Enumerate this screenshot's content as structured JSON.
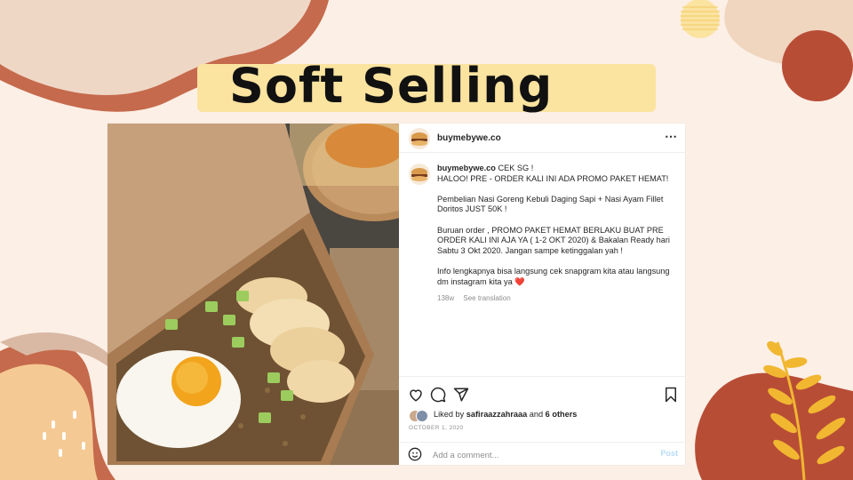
{
  "slide": {
    "title": "Soft Selling",
    "colors": {
      "background": "#fcefe6",
      "title_highlight": "#fbe3a0",
      "terracotta": "#c56a4c",
      "maroon": "#9a3b2c",
      "mustard": "#f1b731"
    }
  },
  "post": {
    "username": "buymebywe.co",
    "more_icon": "⋯",
    "caption": {
      "username": "buymebywe.co",
      "lines": [
        "CEK SG !",
        "HALOO! PRE - ORDER KALI INI ADA PROMO PAKET HEMAT!",
        "Pembelian Nasi Goreng Kebuli Daging Sapi + Nasi Ayam Fillet Doritos JUST 50K !",
        "Buruan order , PROMO PAKET HEMAT BERLAKU BUAT PRE ORDER KALI INI AJA YA ( 1-2 OKT 2020) & Bakalan Ready hari Sabtu 3 Okt 2020. Jangan sampe ketinggalan yah !",
        "Info lengkapnya bisa langsung cek snapgram kita atau langsung dm instagram kita ya ❤️"
      ]
    },
    "age": "138w",
    "see_translation": "See translation",
    "liked_by_prefix": "Liked by ",
    "liked_by_user": "safiraazzahraaa",
    "liked_by_and": " and ",
    "liked_by_others": "6 others",
    "date": "OCTOBER 1, 2020",
    "comment_placeholder": "Add a comment...",
    "post_button": "Post",
    "icons": [
      "heart-icon",
      "comment-icon",
      "share-icon",
      "bookmark-icon",
      "emoji-icon"
    ]
  }
}
